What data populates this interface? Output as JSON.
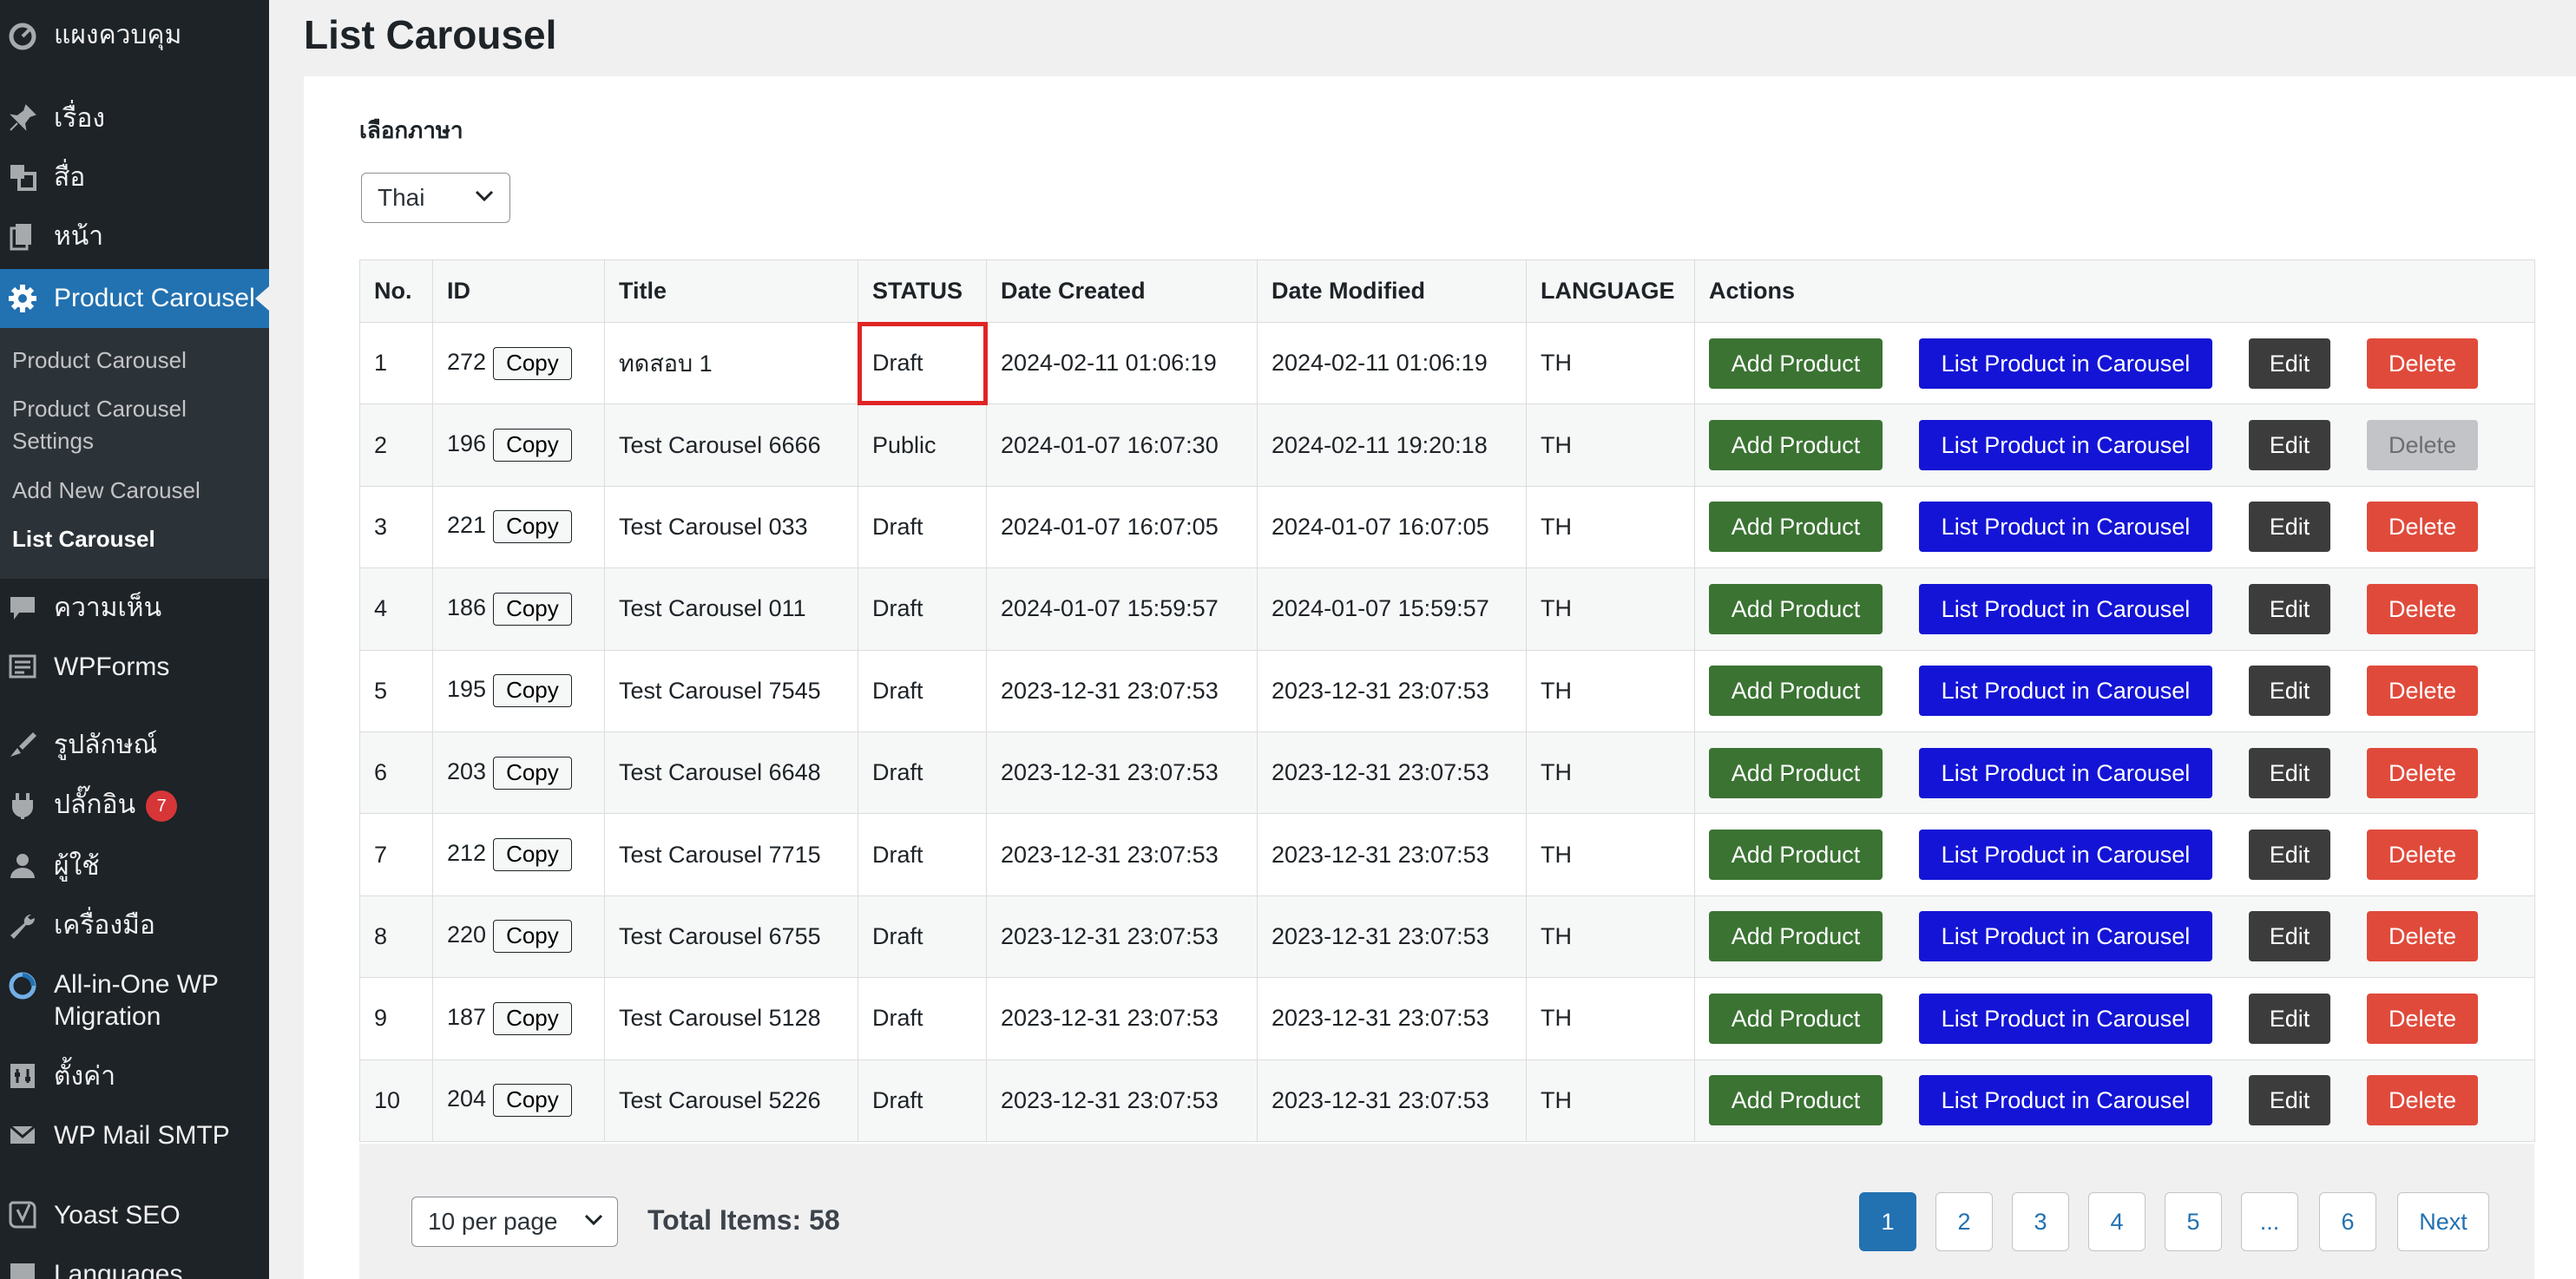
{
  "colors": {
    "sidebar_bg": "#1d2327",
    "submenu_bg": "#2c3338",
    "sidebar_active": "#2271b1",
    "add_product": "#3b7333",
    "list_product": "#1414d6",
    "edit": "#3c3c3c",
    "delete": "#e04a3b",
    "delete_disabled": "#c3c4c7",
    "highlight_box": "#e02424",
    "badge": "#d63638"
  },
  "sidebar": {
    "items": [
      {
        "label": "แผงควบคุม",
        "icon": "dashboard-icon"
      },
      {
        "label": "เรื่อง",
        "icon": "pin-icon"
      },
      {
        "label": "สื่อ",
        "icon": "media-icon"
      },
      {
        "label": "หน้า",
        "icon": "page-icon"
      },
      {
        "label": "Product Carousel",
        "icon": "gear-icon"
      },
      {
        "label": "ความเห็น",
        "icon": "comment-icon"
      },
      {
        "label": "WPForms",
        "icon": "forms-icon"
      },
      {
        "label": "รูปลักษณ์",
        "icon": "brush-icon"
      },
      {
        "label": "ปลั๊กอิน",
        "icon": "plugin-icon",
        "badge": "7"
      },
      {
        "label": "ผู้ใช้",
        "icon": "user-icon"
      },
      {
        "label": "เครื่องมือ",
        "icon": "wrench-icon"
      },
      {
        "label": "All-in-One WP Migration",
        "icon": "migration-icon"
      },
      {
        "label": "ตั้งค่า",
        "icon": "settings-icon"
      },
      {
        "label": "WP Mail SMTP",
        "icon": "mail-icon"
      },
      {
        "label": "Yoast SEO",
        "icon": "yoast-icon"
      },
      {
        "label": "Languages",
        "icon": "languages-icon"
      }
    ],
    "submenu": [
      {
        "label": "Product Carousel"
      },
      {
        "label": "Product Carousel Settings"
      },
      {
        "label": "Add New Carousel"
      },
      {
        "label": "List Carousel",
        "current": true
      }
    ]
  },
  "page": {
    "title": "List Carousel",
    "language_label": "เลือกภาษา",
    "language_selected": "Thai"
  },
  "table": {
    "headers": [
      "No.",
      "ID",
      "Title",
      "STATUS",
      "Date Created",
      "Date Modified",
      "LANGUAGE",
      "Actions"
    ],
    "copy_label": "Copy",
    "actions": {
      "add": "Add Product",
      "list": "List Product in Carousel",
      "edit": "Edit",
      "delete": "Delete"
    },
    "rows": [
      {
        "no": "1",
        "id": "272",
        "title": "ทดสอบ 1",
        "status": "Draft",
        "created": "2024-02-11 01:06:19",
        "modified": "2024-02-11 01:06:19",
        "language": "TH",
        "delete_disabled": false,
        "status_highlighted": true
      },
      {
        "no": "2",
        "id": "196",
        "title": "Test Carousel 6666",
        "status": "Public",
        "created": "2024-01-07 16:07:30",
        "modified": "2024-02-11 19:20:18",
        "language": "TH",
        "delete_disabled": true
      },
      {
        "no": "3",
        "id": "221",
        "title": "Test Carousel 033",
        "status": "Draft",
        "created": "2024-01-07 16:07:05",
        "modified": "2024-01-07 16:07:05",
        "language": "TH",
        "delete_disabled": false
      },
      {
        "no": "4",
        "id": "186",
        "title": "Test Carousel 011",
        "status": "Draft",
        "created": "2024-01-07 15:59:57",
        "modified": "2024-01-07 15:59:57",
        "language": "TH",
        "delete_disabled": false
      },
      {
        "no": "5",
        "id": "195",
        "title": "Test Carousel 7545",
        "status": "Draft",
        "created": "2023-12-31 23:07:53",
        "modified": "2023-12-31 23:07:53",
        "language": "TH",
        "delete_disabled": false
      },
      {
        "no": "6",
        "id": "203",
        "title": "Test Carousel 6648",
        "status": "Draft",
        "created": "2023-12-31 23:07:53",
        "modified": "2023-12-31 23:07:53",
        "language": "TH",
        "delete_disabled": false
      },
      {
        "no": "7",
        "id": "212",
        "title": "Test Carousel 7715",
        "status": "Draft",
        "created": "2023-12-31 23:07:53",
        "modified": "2023-12-31 23:07:53",
        "language": "TH",
        "delete_disabled": false
      },
      {
        "no": "8",
        "id": "220",
        "title": "Test Carousel 6755",
        "status": "Draft",
        "created": "2023-12-31 23:07:53",
        "modified": "2023-12-31 23:07:53",
        "language": "TH",
        "delete_disabled": false
      },
      {
        "no": "9",
        "id": "187",
        "title": "Test Carousel 5128",
        "status": "Draft",
        "created": "2023-12-31 23:07:53",
        "modified": "2023-12-31 23:07:53",
        "language": "TH",
        "delete_disabled": false
      },
      {
        "no": "10",
        "id": "204",
        "title": "Test Carousel 5226",
        "status": "Draft",
        "created": "2023-12-31 23:07:53",
        "modified": "2023-12-31 23:07:53",
        "language": "TH",
        "delete_disabled": false
      }
    ]
  },
  "footer": {
    "per_page": "10 per page",
    "total": "Total Items: 58",
    "pages": [
      "1",
      "2",
      "3",
      "4",
      "5",
      "...",
      "6"
    ],
    "current_page": "1",
    "next": "Next"
  }
}
